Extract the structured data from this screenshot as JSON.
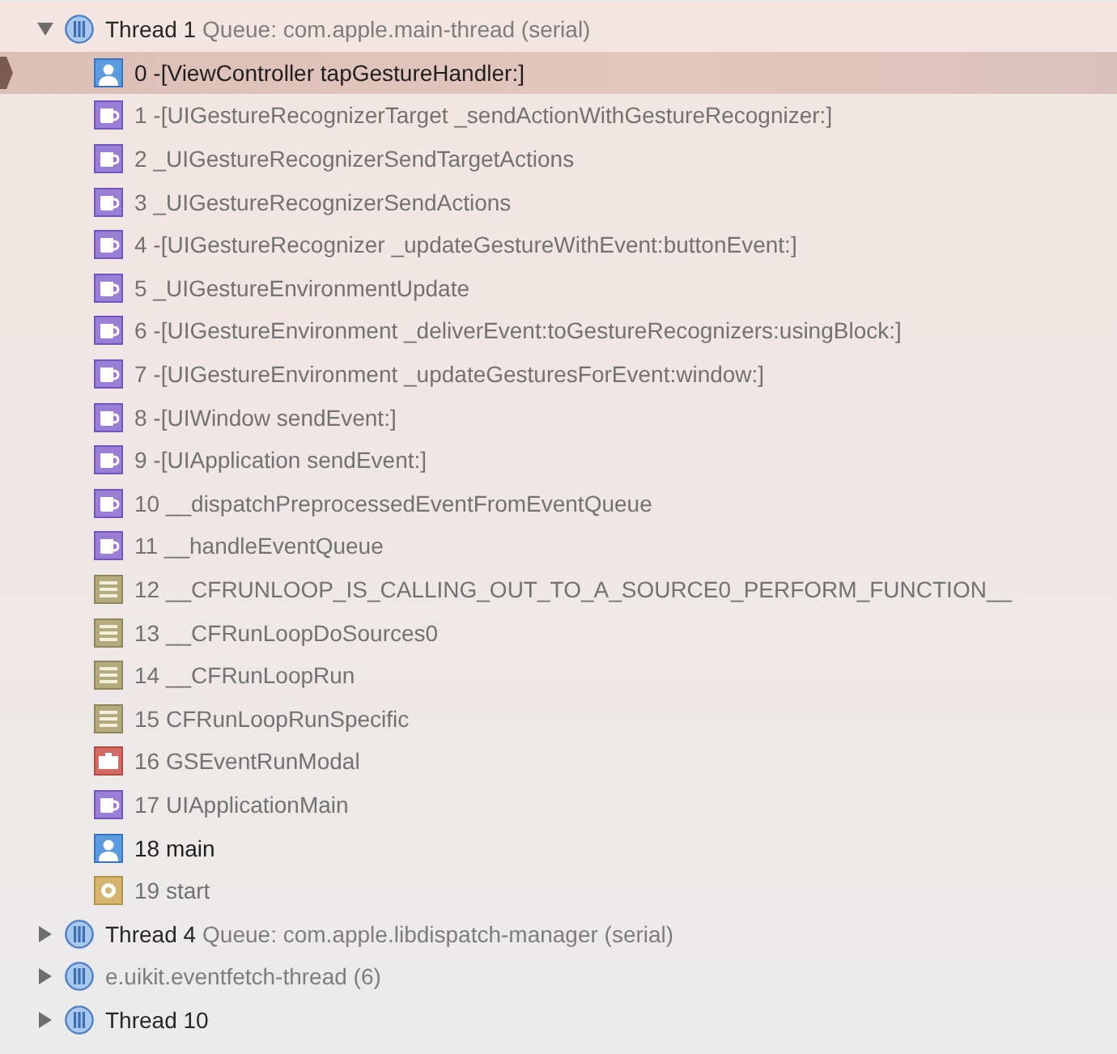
{
  "threads": [
    {
      "name": "Thread 1",
      "queue": "Queue: com.apple.main-thread (serial)",
      "expanded": true,
      "frames": [
        {
          "number": "0",
          "symbol": "-[ViewController tapGestureHandler:]",
          "kind": "user",
          "selected": true
        },
        {
          "number": "1",
          "symbol": "-[UIGestureRecognizerTarget _sendActionWithGestureRecognizer:]",
          "kind": "framework",
          "selected": false
        },
        {
          "number": "2",
          "symbol": "_UIGestureRecognizerSendTargetActions",
          "kind": "framework",
          "selected": false
        },
        {
          "number": "3",
          "symbol": "_UIGestureRecognizerSendActions",
          "kind": "framework",
          "selected": false
        },
        {
          "number": "4",
          "symbol": "-[UIGestureRecognizer _updateGestureWithEvent:buttonEvent:]",
          "kind": "framework",
          "selected": false
        },
        {
          "number": "5",
          "symbol": "_UIGestureEnvironmentUpdate",
          "kind": "framework",
          "selected": false
        },
        {
          "number": "6",
          "symbol": "-[UIGestureEnvironment _deliverEvent:toGestureRecognizers:usingBlock:]",
          "kind": "framework",
          "selected": false
        },
        {
          "number": "7",
          "symbol": "-[UIGestureEnvironment _updateGesturesForEvent:window:]",
          "kind": "framework",
          "selected": false
        },
        {
          "number": "8",
          "symbol": "-[UIWindow sendEvent:]",
          "kind": "framework",
          "selected": false
        },
        {
          "number": "9",
          "symbol": "-[UIApplication sendEvent:]",
          "kind": "framework",
          "selected": false
        },
        {
          "number": "10",
          "symbol": "__dispatchPreprocessedEventFromEventQueue",
          "kind": "framework",
          "selected": false
        },
        {
          "number": "11",
          "symbol": "__handleEventQueue",
          "kind": "framework",
          "selected": false
        },
        {
          "number": "12",
          "symbol": "__CFRUNLOOP_IS_CALLING_OUT_TO_A_SOURCE0_PERFORM_FUNCTION__",
          "kind": "corefoundation",
          "selected": false
        },
        {
          "number": "13",
          "symbol": "__CFRunLoopDoSources0",
          "kind": "corefoundation",
          "selected": false
        },
        {
          "number": "14",
          "symbol": "__CFRunLoopRun",
          "kind": "corefoundation",
          "selected": false
        },
        {
          "number": "15",
          "symbol": "CFRunLoopRunSpecific",
          "kind": "corefoundation",
          "selected": false
        },
        {
          "number": "16",
          "symbol": "GSEventRunModal",
          "kind": "graphics",
          "selected": false
        },
        {
          "number": "17",
          "symbol": "UIApplicationMain",
          "kind": "framework",
          "selected": false
        },
        {
          "number": "18",
          "symbol": "main",
          "kind": "user",
          "selected": false
        },
        {
          "number": "19",
          "symbol": "start",
          "kind": "system",
          "selected": false
        }
      ]
    },
    {
      "name": "Thread 4",
      "queue": "Queue: com.apple.libdispatch-manager (serial)",
      "expanded": false
    },
    {
      "queue": "e.uikit.eventfetch-thread (6)",
      "expanded": false
    },
    {
      "name": "Thread 10",
      "expanded": false
    }
  ]
}
